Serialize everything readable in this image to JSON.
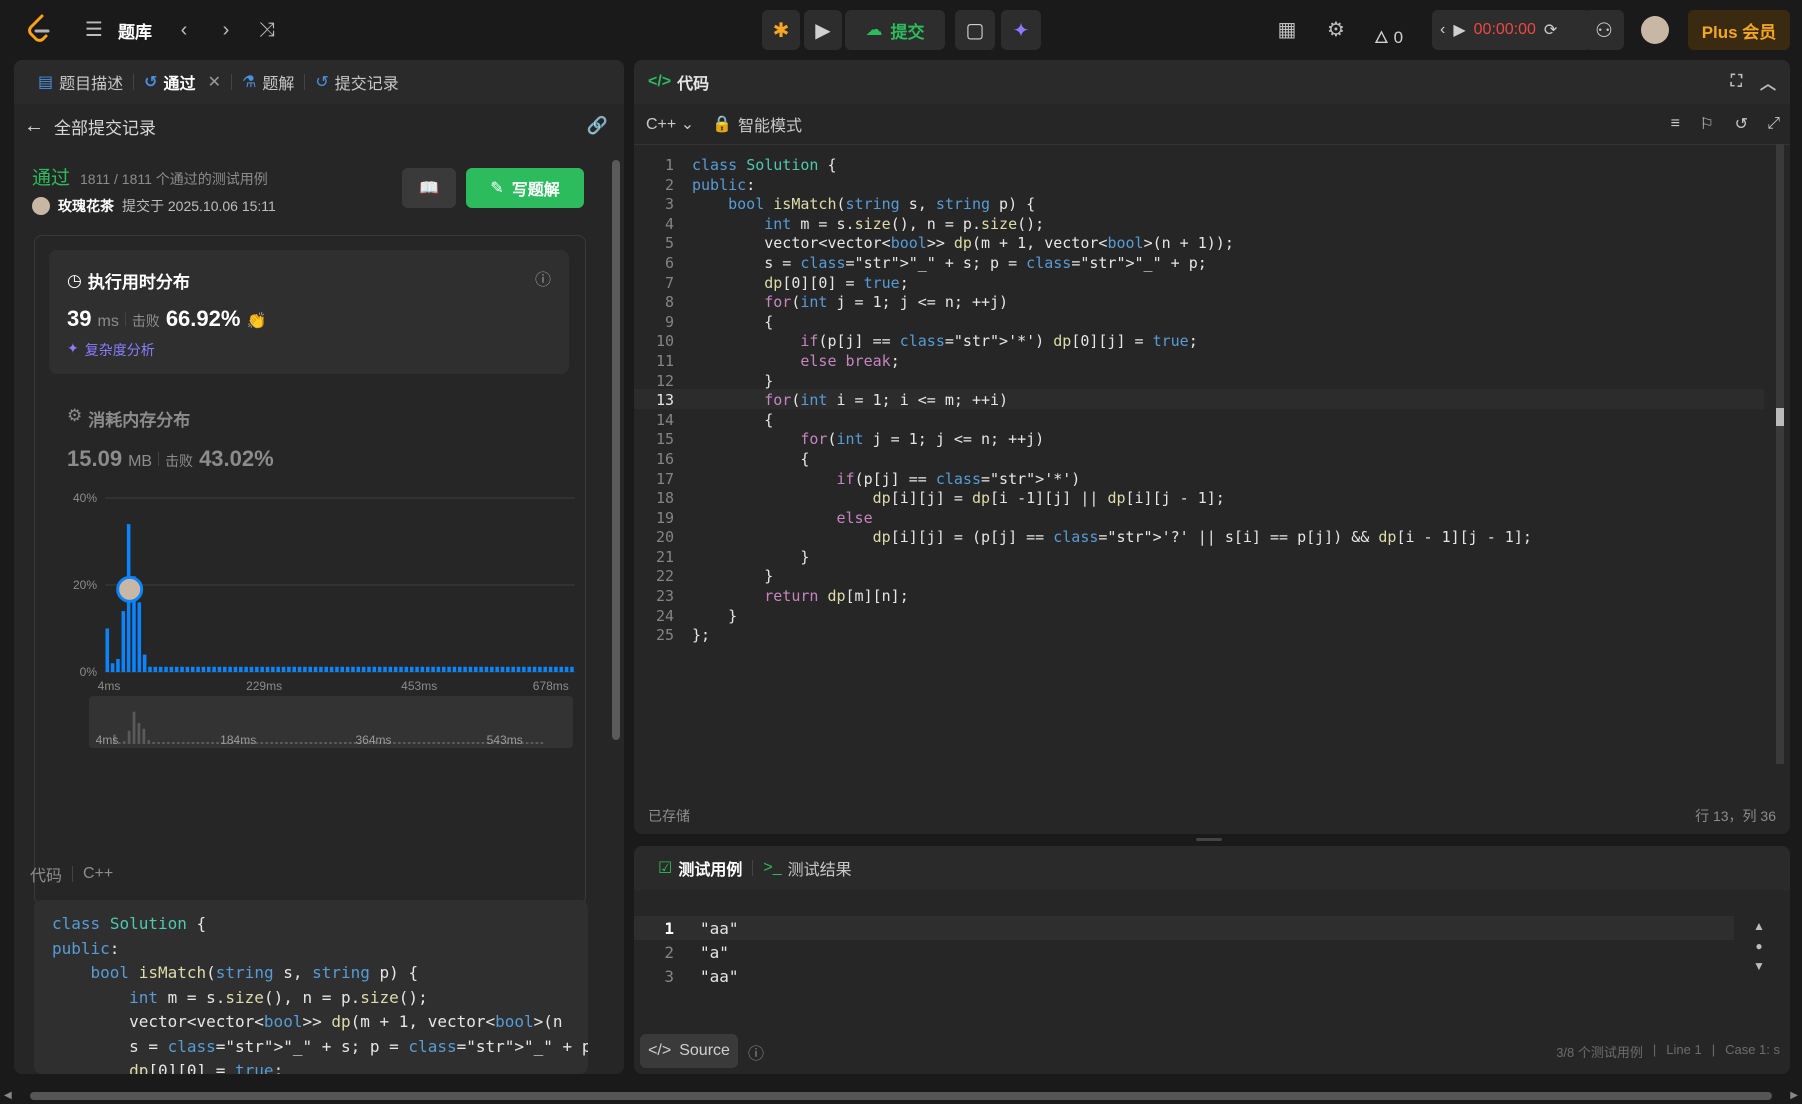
{
  "topbar": {
    "problem_bank": "题库",
    "submit_label": "提交",
    "fire_count": "0",
    "timer": "00:00:00",
    "plus_label": "Plus 会员"
  },
  "left": {
    "tabs": [
      {
        "label": "题目描述",
        "icon": "doc-icon"
      },
      {
        "label": "通过",
        "icon": "history-icon"
      },
      {
        "label": "题解",
        "icon": "flask-icon"
      },
      {
        "label": "提交记录",
        "icon": "history-icon"
      }
    ],
    "back_label": "全部提交记录",
    "status": "通过",
    "status_detail": "1811 / 1811 个通过的测试用例",
    "user": "玫瑰花茶",
    "submitted_at": "提交于 2025.10.06 15:11",
    "write_solution": "写题解",
    "runtime": {
      "title": "执行用时分布",
      "value": "39",
      "unit": "ms",
      "beat_label": "击败",
      "beat_value": "66.92%",
      "complexity_link": "复杂度分析"
    },
    "memory": {
      "title": "消耗内存分布",
      "value": "15.09",
      "unit": "MB",
      "beat_label": "击败",
      "beat_value": "43.02%"
    },
    "code_label": "代码",
    "code_lang": "C++",
    "code_preview": [
      "class Solution {",
      "public:",
      "    bool isMatch(string s, string p) {",
      "        int m = s.size(), n = p.size();",
      "        vector<vector<bool>> dp(m + 1, vector<bool>(n",
      "        s = \"_\" + s; p = \"_\" + p;",
      "        dp[0][0] = true;"
    ]
  },
  "chart_data": {
    "type": "bar",
    "title": "",
    "ylabel": "",
    "xlabel": "",
    "ylim": [
      0,
      40
    ],
    "y_ticks": [
      "40%",
      "20%",
      "0%"
    ],
    "x_ticks": [
      "4ms",
      "229ms",
      "453ms",
      "678ms"
    ],
    "mini_x_ticks": [
      "4ms",
      "184ms",
      "364ms",
      "543ms"
    ],
    "values": [
      10,
      2,
      3,
      14,
      34,
      22,
      16,
      4,
      1.2,
      1.2,
      1.2,
      1.2,
      1.2,
      1.2,
      1.2,
      1.2,
      1.2,
      1.2,
      1.2,
      1.2,
      1.2,
      1.2,
      1.2,
      1.2,
      1.2,
      1.2,
      1.2,
      1.2,
      1.2,
      1.2,
      1.2,
      1.2,
      1.2,
      1.2,
      1.2,
      1.2,
      1.2,
      1.2,
      1.2,
      1.2,
      1.2,
      1.2,
      1.2,
      1.2,
      1.2,
      1.2,
      1.2,
      1.2,
      1.2,
      1.2,
      1.2,
      1.2,
      1.2,
      1.2,
      1.2,
      1.2,
      1.2,
      1.2,
      1.2,
      1.2,
      1.2,
      1.2,
      1.2,
      1.2,
      1.2,
      1.2,
      1.2,
      1.2,
      1.2,
      1.2,
      1.2,
      1.2,
      1.2,
      1.2,
      1.2,
      1.2,
      1.2,
      1.2,
      1.2,
      1.2,
      1.2,
      1.2,
      1.2,
      1.2,
      1.2,
      1.2,
      1.2,
      1.2
    ],
    "user_marker_value": 19,
    "grid": true
  },
  "editor": {
    "title": "代码",
    "language": "C++",
    "mode": "智能模式",
    "saved": "已存储",
    "cursor": "行 13，列 36",
    "lines": [
      "class Solution {",
      "public:",
      "    bool isMatch(string s, string p) {",
      "        int m = s.size(), n = p.size();",
      "        vector<vector<bool>> dp(m + 1, vector<bool>(n + 1));",
      "        s = \"_\" + s; p = \"_\" + p;",
      "        dp[0][0] = true;",
      "        for(int j = 1; j <= n; ++j)",
      "        {",
      "            if(p[j] == '*') dp[0][j] = true;",
      "            else break;",
      "        }",
      "        for(int i = 1; i <= m; ++i)",
      "        {",
      "            for(int j = 1; j <= n; ++j)",
      "            {",
      "                if(p[j] == '*')",
      "                    dp[i][j] = dp[i -1][j] || dp[i][j - 1];",
      "                else",
      "                    dp[i][j] = (p[j] == '?' || s[i] == p[j]) && dp[i - 1][j - 1];",
      "            }",
      "        }",
      "        return dp[m][n];",
      "    }",
      "};"
    ]
  },
  "testcase": {
    "tab_cases": "测试用例",
    "tab_result": "测试结果",
    "lines": [
      "\"aa\"",
      "\"a\"",
      "\"aa\""
    ],
    "source_label": "Source",
    "footer_cases": "3/8 个测试用例",
    "footer_line": "Line 1",
    "footer_case": "Case 1: s"
  }
}
